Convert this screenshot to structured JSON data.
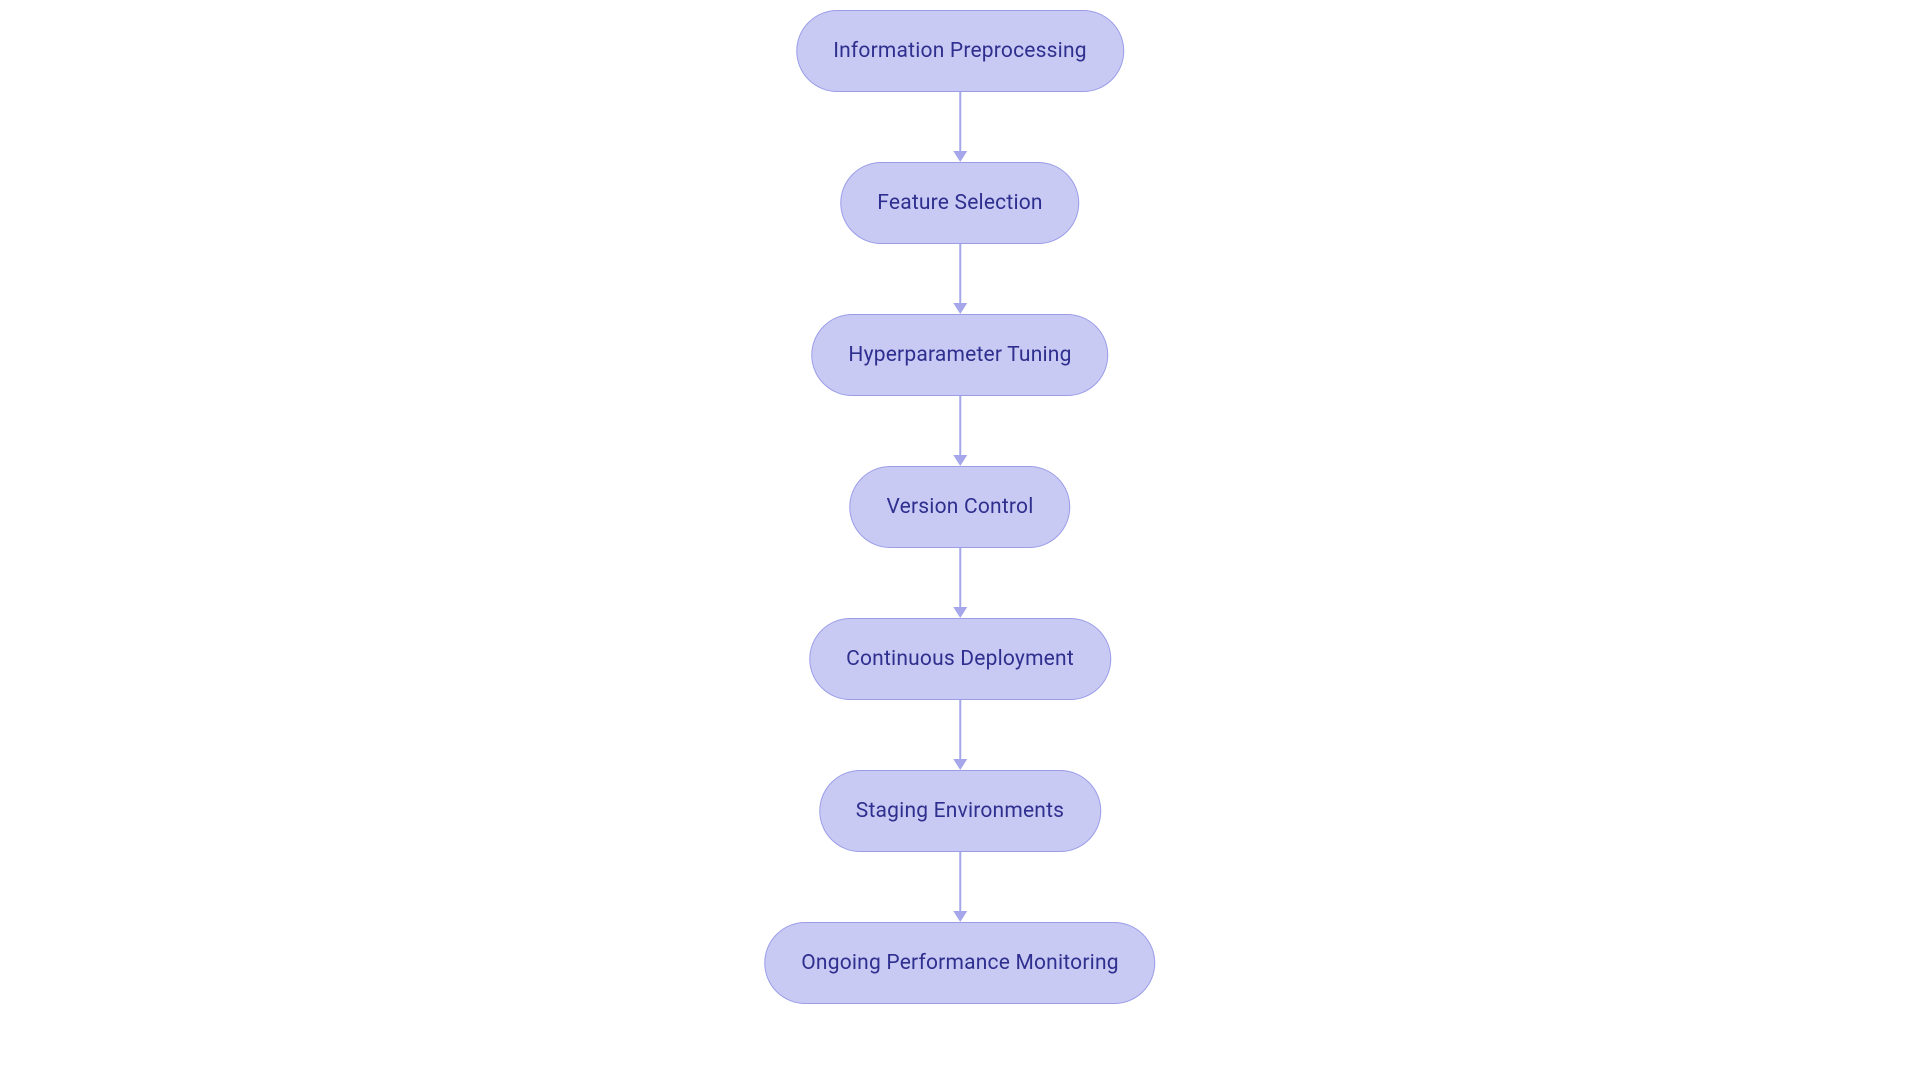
{
  "flowchart": {
    "nodes": [
      {
        "id": "info-preprocessing",
        "label": "Information Preprocessing"
      },
      {
        "id": "feature-selection",
        "label": "Feature Selection"
      },
      {
        "id": "hyperparameter-tuning",
        "label": "Hyperparameter Tuning"
      },
      {
        "id": "version-control",
        "label": "Version Control"
      },
      {
        "id": "continuous-deployment",
        "label": "Continuous Deployment"
      },
      {
        "id": "staging-environments",
        "label": "Staging Environments"
      },
      {
        "id": "ongoing-monitoring",
        "label": "Ongoing Performance Monitoring"
      }
    ],
    "colors": {
      "node_fill": "#c9caf4",
      "node_border": "#9b9de8",
      "text": "#2e2f8e",
      "connector": "#a5a7ea"
    }
  }
}
